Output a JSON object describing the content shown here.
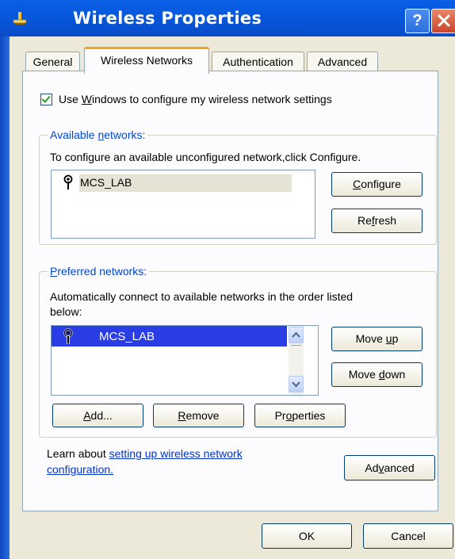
{
  "window": {
    "title": "Wireless Properties",
    "help_glyph": "?"
  },
  "tabs": [
    {
      "label": "General",
      "active": false
    },
    {
      "label": "Wireless Networks",
      "active": true
    },
    {
      "label": "Authentication",
      "active": false
    },
    {
      "label": "Advanced",
      "active": false
    }
  ],
  "use_windows": {
    "checked": true,
    "label_pre": "Use ",
    "label_key": "W",
    "label_post": "indows to configure my wireless network settings"
  },
  "available": {
    "legend_pre": "Available ",
    "legend_key": "n",
    "legend_post": "etworks:",
    "description": "To configure an available unconfigured network,click Configure.",
    "networks": [
      {
        "name": "MCS_LAB",
        "icon": "wireless-antenna-icon"
      }
    ],
    "configure_key": "C",
    "configure_rest": "onfigure",
    "refresh_pre": "Re",
    "refresh_key": "f",
    "refresh_post": "resh"
  },
  "preferred": {
    "legend_pre": "",
    "legend_key": "P",
    "legend_post": "referred networks:",
    "description_line1": "Automatically connect to available networks in the order listed",
    "description_line2": "below:",
    "networks": [
      {
        "name": "MCS_LAB",
        "icon": "wireless-antenna-icon",
        "selected": true
      }
    ],
    "move_up_pre": "Move ",
    "move_up_key": "u",
    "move_up_post": "p",
    "move_down_pre": "Move ",
    "move_down_key": "d",
    "move_down_post": "own",
    "add_key": "A",
    "add_rest": "dd...",
    "remove_key": "R",
    "remove_rest": "emove",
    "properties_pre": "Pr",
    "properties_key": "o",
    "properties_post": "perties"
  },
  "learn": {
    "prefix": "Learn about ",
    "link_line1": "setting up wireless network",
    "link_line2": "configuration."
  },
  "advanced_button": {
    "pre": "Ad",
    "key": "v",
    "post": "anced"
  },
  "dialog_buttons": {
    "ok": "OK",
    "cancel": "Cancel"
  },
  "colors": {
    "titlebar": "#0655d8",
    "selection": "#2a3ee6",
    "group_legend": "#0046d5",
    "link": "#0033cc"
  }
}
